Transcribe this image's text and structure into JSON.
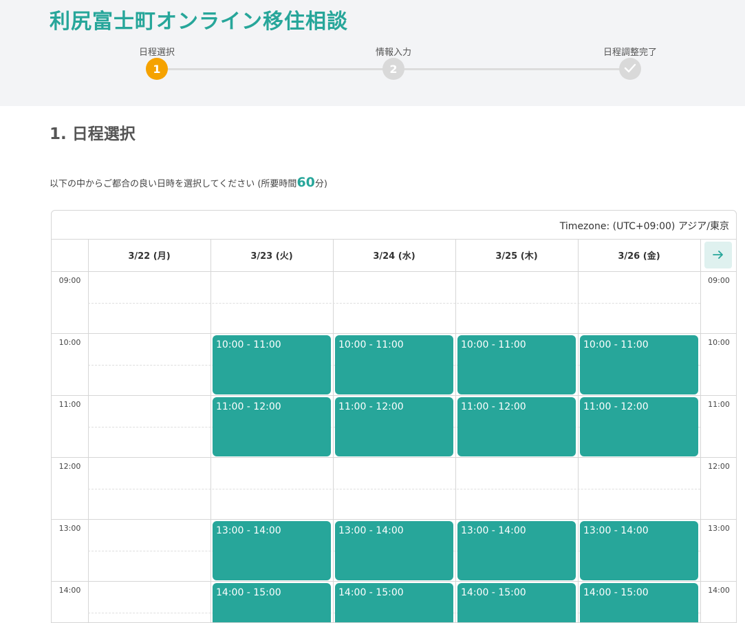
{
  "app": {
    "title": "利尻富士町オンライン移住相談"
  },
  "stepper": {
    "steps": [
      {
        "label": "日程選択",
        "marker": "1",
        "state": "active"
      },
      {
        "label": "情報入力",
        "marker": "2",
        "state": "pending"
      },
      {
        "label": "日程調整完了",
        "marker": "✓",
        "icon": "check-icon",
        "state": "pending"
      }
    ]
  },
  "section": {
    "title": "1. 日程選択",
    "instruction_prefix": "以下の中からご都合の良い日時を選択してください (所要時間",
    "duration": "60",
    "instruction_suffix": "分)"
  },
  "calendar": {
    "timezone": "Timezone: (UTC+09:00) アジア/東京",
    "next_icon": "arrow-right-icon",
    "days": [
      "3/22 (月)",
      "3/23 (火)",
      "3/24 (水)",
      "3/25 (木)",
      "3/26 (金)"
    ],
    "hours": [
      "09:00",
      "10:00",
      "11:00",
      "12:00",
      "13:00",
      "14:00"
    ],
    "slots": [
      {
        "day": 1,
        "hour": 1,
        "label": "10:00 - 11:00"
      },
      {
        "day": 2,
        "hour": 1,
        "label": "10:00 - 11:00"
      },
      {
        "day": 3,
        "hour": 1,
        "label": "10:00 - 11:00"
      },
      {
        "day": 4,
        "hour": 1,
        "label": "10:00 - 11:00"
      },
      {
        "day": 1,
        "hour": 2,
        "label": "11:00 - 12:00"
      },
      {
        "day": 2,
        "hour": 2,
        "label": "11:00 - 12:00"
      },
      {
        "day": 3,
        "hour": 2,
        "label": "11:00 - 12:00"
      },
      {
        "day": 4,
        "hour": 2,
        "label": "11:00 - 12:00"
      },
      {
        "day": 1,
        "hour": 4,
        "label": "13:00 - 14:00"
      },
      {
        "day": 2,
        "hour": 4,
        "label": "13:00 - 14:00"
      },
      {
        "day": 3,
        "hour": 4,
        "label": "13:00 - 14:00"
      },
      {
        "day": 4,
        "hour": 4,
        "label": "13:00 - 14:00"
      },
      {
        "day": 1,
        "hour": 5,
        "label": "14:00 - 15:00"
      },
      {
        "day": 2,
        "hour": 5,
        "label": "14:00 - 15:00"
      },
      {
        "day": 3,
        "hour": 5,
        "label": "14:00 - 15:00"
      },
      {
        "day": 4,
        "hour": 5,
        "label": "14:00 - 15:00"
      }
    ]
  },
  "colors": {
    "accent": "#27a69a",
    "step_active": "#f5a200",
    "step_pending": "#d9d9d9"
  }
}
